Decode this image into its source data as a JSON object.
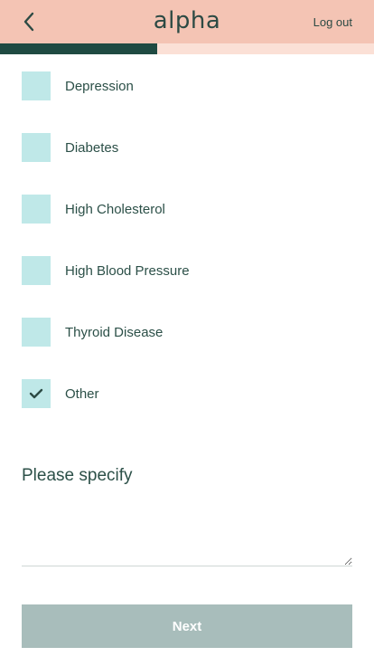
{
  "header": {
    "back_icon": "chevron-left-icon",
    "logo": "alpha",
    "logout_label": "Log out",
    "background": "#f4c4b4"
  },
  "progress": {
    "fraction": 0.42,
    "fill_color": "#1f4a42",
    "track_color": "#fbe0d6"
  },
  "conditions": [
    {
      "label": "Depression",
      "checked": false
    },
    {
      "label": "Diabetes",
      "checked": false
    },
    {
      "label": "High Cholesterol",
      "checked": false
    },
    {
      "label": "High Blood Pressure",
      "checked": false
    },
    {
      "label": "Thyroid Disease",
      "checked": false
    },
    {
      "label": "Other",
      "checked": true
    }
  ],
  "specify": {
    "label": "Please specify",
    "value": ""
  },
  "next_button": {
    "label": "Next",
    "color": "#a8bdbb"
  },
  "checkbox_color": "#bfe8e8"
}
